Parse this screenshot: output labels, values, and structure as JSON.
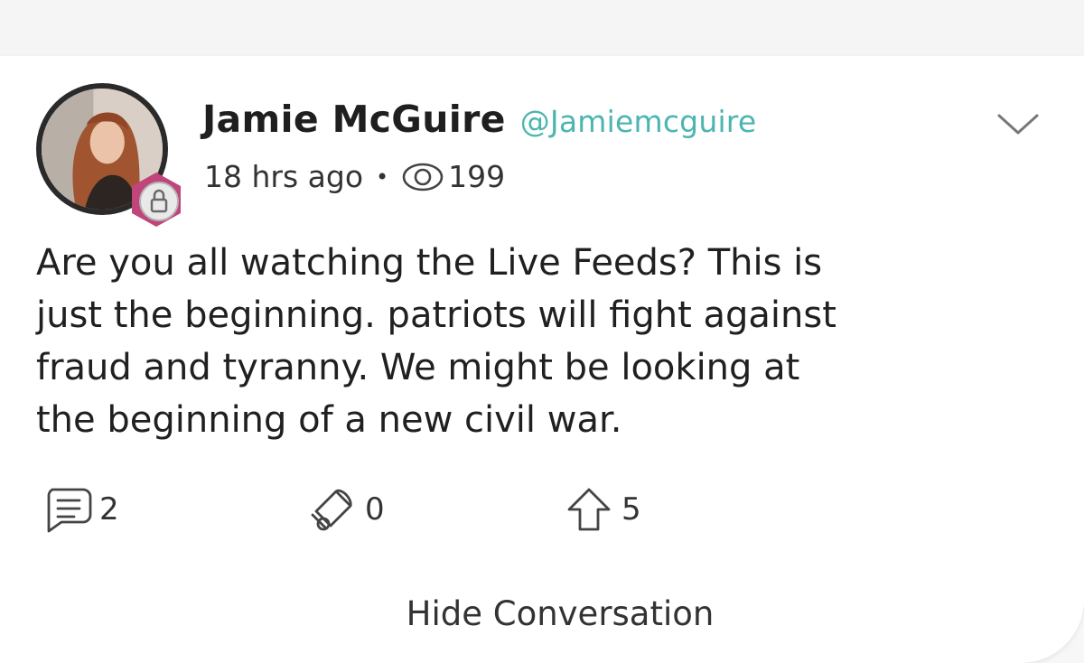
{
  "post": {
    "author_name": "Jamie McGuire",
    "author_handle": "@Jamiemcguire",
    "time_ago": "18 hrs ago",
    "views": "199",
    "body_lines": [
      "Are you all watching the Live Feeds? This is",
      "just the beginning. patriots will fight against",
      "fraud and tyranny. We might be looking at",
      "the beginning of a new civil war."
    ]
  },
  "actions": {
    "comments_count": "2",
    "echoes_count": "0",
    "upvotes_count": "5"
  },
  "footer": {
    "hide_conversation_label": "Hide Conversation"
  },
  "icons": {
    "avatar": "avatar-photo",
    "badge": "lock-badge-icon",
    "more": "chevron-down-icon",
    "views": "eye-icon",
    "comment": "comment-icon",
    "echo": "echo-megaphone-icon",
    "upvote": "upvote-arrow-icon"
  },
  "colors": {
    "handle": "#4cb5b1",
    "badge": "#c0457a",
    "text": "#222222",
    "background": "#ffffff"
  }
}
